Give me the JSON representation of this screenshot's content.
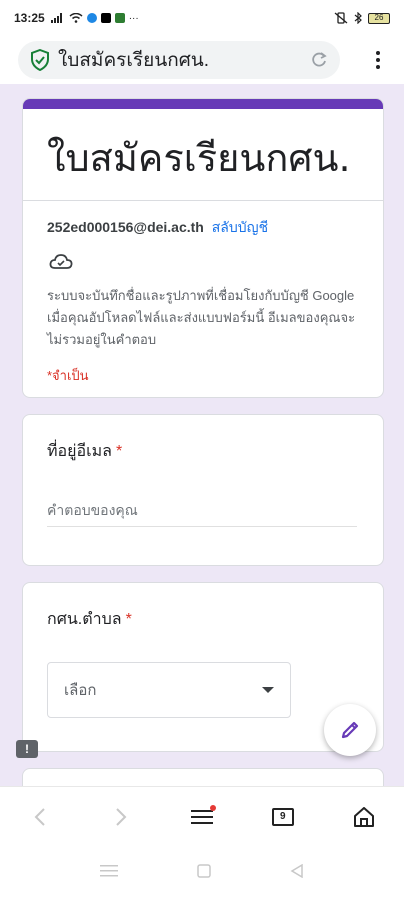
{
  "status_bar": {
    "time": "13:25",
    "signal_icon": "signal-bars-icon",
    "wifi_icon": "wifi-icon",
    "battery_level": "26",
    "colors": {
      "app1": "#1e88e5",
      "app2": "#000000",
      "app3": "#2e7d32"
    }
  },
  "browser": {
    "url_title": "ใบสมัครเรียนกศน.",
    "secure_icon": "shield-check-icon",
    "reload_icon": "reload-icon",
    "menu_icon": "more-vert-icon"
  },
  "form": {
    "accent_color": "#673ab7",
    "title": "ใบสมัครเรียนกศน.",
    "account_email": "252ed000156@dei.ac.th",
    "switch_account": "สลับบัญชี",
    "cloud_icon": "cloud-off-icon",
    "notice": "ระบบจะบันทึกชื่อและรูปภาพที่เชื่อมโยงกับบัญชี Google เมื่อคุณอัปโหลดไฟล์และส่งแบบฟอร์มนี้ อีเมลของคุณจะไม่รวมอยู่ในคำตอบ",
    "required_note": "*จำเป็น",
    "questions": [
      {
        "label": "ที่อยู่อีเมล",
        "required_mark": "*",
        "placeholder": "คำตอบของคุณ"
      },
      {
        "label": "กศน.ตำบล",
        "required_mark": "*",
        "select_value": "เลือก"
      }
    ]
  },
  "fab": {
    "icon": "pencil-edit-icon"
  },
  "feedback": {
    "icon": "feedback-icon",
    "glyph": "!"
  },
  "toolbar": {
    "back_icon": "back-arrow-icon",
    "forward_icon": "forward-arrow-icon",
    "menu_icon": "hamburger-menu-icon",
    "tabs_icon": "tabs-icon",
    "tabs_count": "9",
    "home_icon": "home-icon"
  },
  "system_nav": {
    "recents_icon": "recents-icon",
    "home_icon": "square-home-icon",
    "back_icon": "triangle-back-icon"
  }
}
